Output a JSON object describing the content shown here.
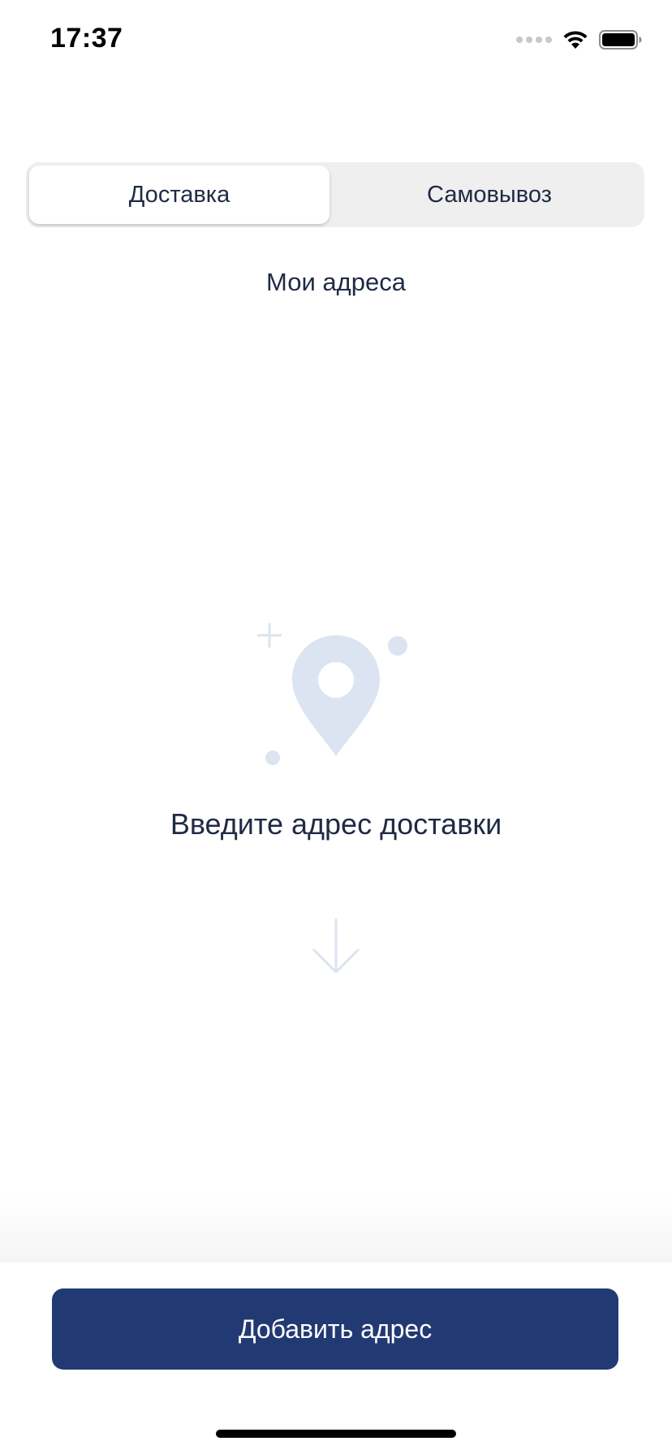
{
  "status_bar": {
    "time": "17:37"
  },
  "tabs": [
    {
      "label": "Доставка",
      "active": true
    },
    {
      "label": "Самовывоз",
      "active": false
    }
  ],
  "section": {
    "title": "Мои адреса"
  },
  "empty_state": {
    "icon": "map-pin-icon",
    "message": "Введите адрес доставки",
    "arrow_icon": "arrow-down-icon"
  },
  "actions": {
    "add_address_label": "Добавить адрес"
  },
  "colors": {
    "primary": "#223a73",
    "text": "#1f2a44",
    "illustration": "#dbe4f0",
    "segment_bg": "#efefef"
  }
}
